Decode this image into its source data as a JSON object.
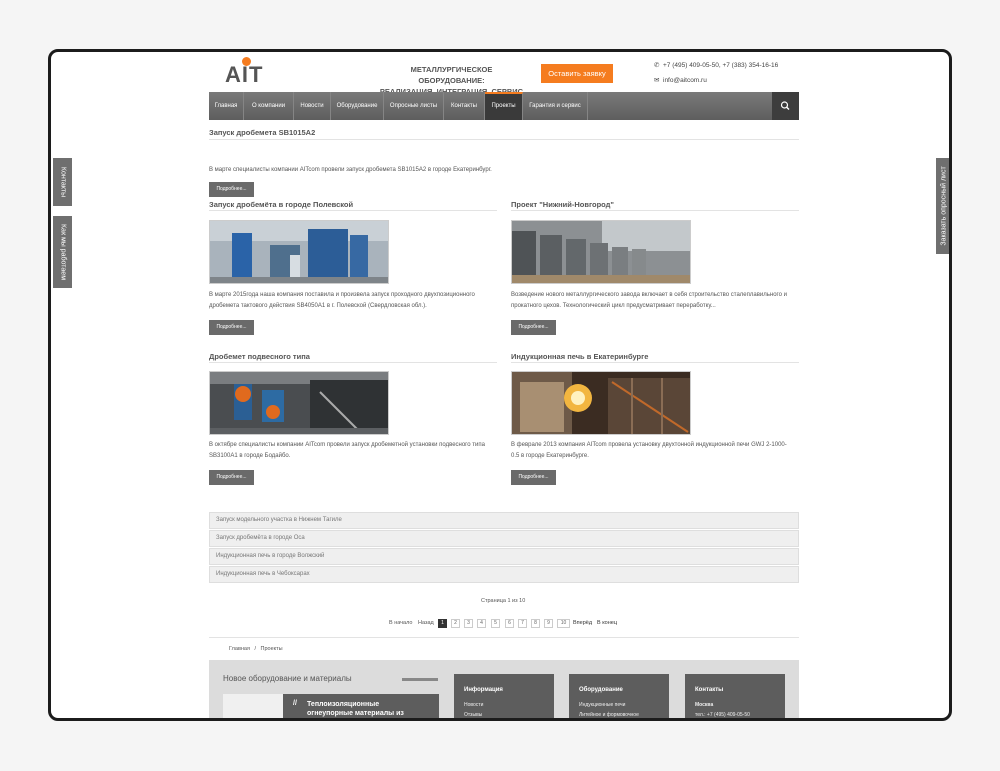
{
  "side_tabs": {
    "contacts": "Контакты",
    "how_we_work": "Как мы работаем",
    "order_form": "Заказать опросный лист"
  },
  "header": {
    "logo": "AIT",
    "tagline_line1": "МЕТАЛЛУРГИЧЕСКОЕ ОБОРУДОВАНИЕ:",
    "tagline_line2": "РЕАЛИЗАЦИЯ, ИНТЕГРАЦИЯ, СЕРВИС",
    "request_button": "Оставить заявку",
    "phone": "+7 (495) 409-05-50, +7 (383) 354-16-16",
    "email": "info@aitcom.ru"
  },
  "nav": {
    "items": [
      "Главная",
      "О компании",
      "Новости",
      "Оборудование",
      "Опросные листы",
      "Контакты",
      "Проекты",
      "Гарантия и сервис"
    ],
    "active": "Проекты"
  },
  "featured": {
    "title": "Запуск дробемета SB1015A2",
    "text": "В марте специалисты компании AITcom провели запуск дробемета SB1015A2 в городе Екатеринбург.",
    "more": "Подробнее..."
  },
  "projects": [
    {
      "title": "Запуск дробемёта в городе Полевской",
      "text_line1": "В марте 2015года наша компания поставила и произвела запуск проходного двухпозиционного",
      "text_line2": "дробемета тактового действия SB4050A1 в г. Полевской (Свердловская обл.).",
      "more": "Подробнее..."
    },
    {
      "title": "Проект \"Нижний-Новгород\"",
      "text_line1": "Возведение нового металлургического завода включает в себя строительство сталеплавильного и",
      "text_line2": "прокатного цехов. Технологический цикл предусматривает переработку...",
      "more": "Подробнее..."
    },
    {
      "title": "Дробемет подвесного типа",
      "text_line1": "В октябре специалисты компании AITcom провели запуск дробеметной установки подвесного типа",
      "text_line2": "SB3100A1 в городе Бодайбо.",
      "more": "Подробнее..."
    },
    {
      "title": "Индукционная печь в Екатеринбурге",
      "text_line1": "В феврале 2013 компания AITcom провела установку двухтонной индукционной печи GWJ 2-1000-",
      "text_line2": "0.5 в городе Екатеринбурге.",
      "more": "Подробнее..."
    }
  ],
  "more_projects": [
    "Запуск модельного участка в Нижнем Тагиле",
    "Запуск дробемёта в городе Оса",
    "Индукционная печь в городе Волжский",
    "Индукционная печь в Чебоксарах"
  ],
  "pagination": {
    "summary": "Страница 1 из 10",
    "start": "В начало",
    "prev": "Назад",
    "pages": [
      "1",
      "2",
      "3",
      "4",
      "5",
      "6",
      "7",
      "8",
      "9",
      "10"
    ],
    "current": "1",
    "next": "Вперёд",
    "end": "В конец"
  },
  "breadcrumb": {
    "home": "Главная",
    "sep": "/",
    "current": "Проекты"
  },
  "footer": {
    "new_title": "Новое оборудование и материалы",
    "card_title_line1": "Теплоизоляционные",
    "card_title_line2": "огнеупорные материалы из",
    "info": {
      "title": "Информация",
      "items": [
        "Новости",
        "Отзывы"
      ]
    },
    "equipment": {
      "title": "Оборудование",
      "items": [
        "Индукционные печи",
        "Литейное и формовочное"
      ]
    },
    "contacts": {
      "title": "Контакты",
      "city": "Москва",
      "phone": "тел.: +7 (495) 409-05-50"
    }
  },
  "colors": {
    "accent": "#f57c1f",
    "nav": "#6a6a6a",
    "nav_active": "#3a3a3a"
  }
}
